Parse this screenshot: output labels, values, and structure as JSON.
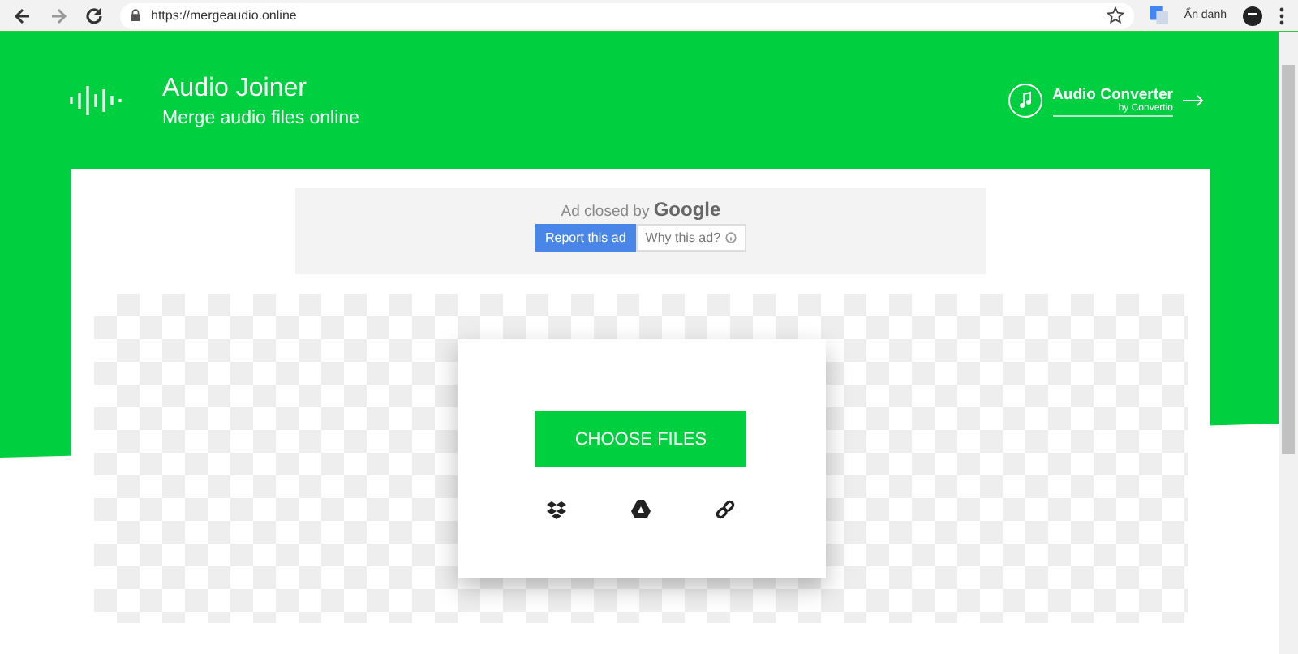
{
  "browser": {
    "url": "https://mergeaudio.online",
    "profile": "Ẩn danh"
  },
  "header": {
    "title": "Audio Joiner",
    "subtitle": "Merge audio files online",
    "link": {
      "label": "Audio Converter",
      "byline": "by Convertio"
    }
  },
  "ad": {
    "text": "Ad closed by",
    "brand": "Google",
    "buttons": [
      {
        "label": "Report this ad",
        "selected": true
      },
      {
        "label": "Why this ad?",
        "selected": false
      }
    ]
  },
  "upload": {
    "button": "CHOOSE FILES",
    "sources": [
      {
        "kind": "dropbox"
      },
      {
        "kind": "drive"
      },
      {
        "kind": "link"
      }
    ]
  }
}
